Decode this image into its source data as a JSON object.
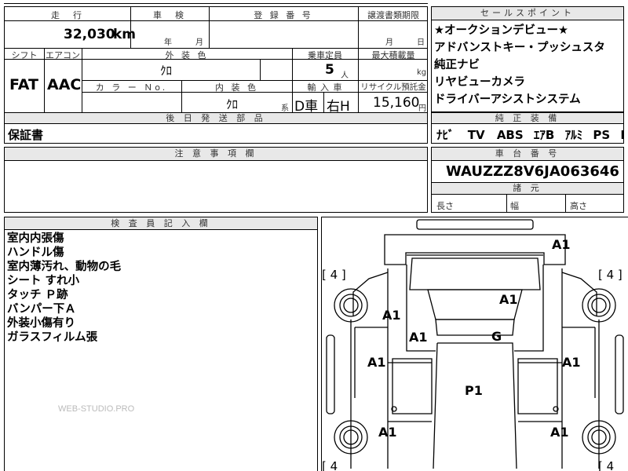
{
  "top": {
    "labels": {
      "mileage": "走　行",
      "inspection": "車　検",
      "registration": "登 録 番 号",
      "transfer_deadline": "譲渡書類期限",
      "shift": "シフト",
      "aircon": "エアコン",
      "exterior_color": "外 装 色",
      "capacity": "乗車定員",
      "max_load": "最大積載量",
      "color_no": "カ ラ ー Ｎo.",
      "interior_color": "内 装 色",
      "import": "輸 入 車",
      "recycle_fee": "リサイクル預託金",
      "later_parts": "後 日 発 送 部 品"
    },
    "mileage_value": "32,030",
    "mileage_unit": "km",
    "year_label": "年",
    "month_label": "月",
    "transfer_month": "月",
    "transfer_day": "日",
    "shift_value": "FAT",
    "aircon_value": "AAC",
    "exterior_color_value": "ｸﾛ",
    "capacity_value": "5",
    "capacity_unit": "人",
    "max_load_unit": "kg",
    "interior_color_value": "ｸﾛ",
    "interior_suffix": "系",
    "import_value_1": "D車",
    "import_value_2": "右H",
    "recycle_value": "15,160",
    "recycle_unit": "円",
    "later_parts_value": "保証書"
  },
  "sales_points": {
    "title": "セールスポイント",
    "lines": [
      "★オークションデビュー★",
      "アドバンストキー・プッシュスタ",
      "純正ナビ",
      "リヤビューカメラ",
      "ドライバーアシストシステム"
    ]
  },
  "equipment": {
    "title": "純 正 装 備",
    "items": [
      "ﾅﾋﾞ",
      "TV",
      "ABS",
      "ｴｱB",
      "ｱﾙﾐ",
      "PS",
      "PW"
    ]
  },
  "notes": {
    "title": "注 意 事 項 欄"
  },
  "chassis": {
    "title": "車 台 番 号",
    "value": "WAUZZZ8V6JA063646",
    "dims_title": "諸 元",
    "length_label": "長さ",
    "width_label": "幅",
    "height_label": "高さ"
  },
  "inspector": {
    "title": "検 査 員 記 入 欄",
    "lines": [
      "室内内張傷",
      "ハンドル傷",
      "室内薄汚れ、動物の毛",
      "シート すれ小",
      "タッチ Ｐ跡",
      "バンパー下Ａ",
      "外装小傷有り",
      "ガラスフィルム張"
    ],
    "watermark": "WEB-STUDIO.PRO"
  },
  "diagram": {
    "tire_labels": [
      "[ 4 ]",
      "[ 4 ]",
      "[ 4",
      "[ 4"
    ],
    "marks": [
      "A1",
      "A1",
      "A1",
      "A1",
      "G",
      "A1",
      "A1",
      "P1",
      "A1",
      "A1"
    ]
  }
}
